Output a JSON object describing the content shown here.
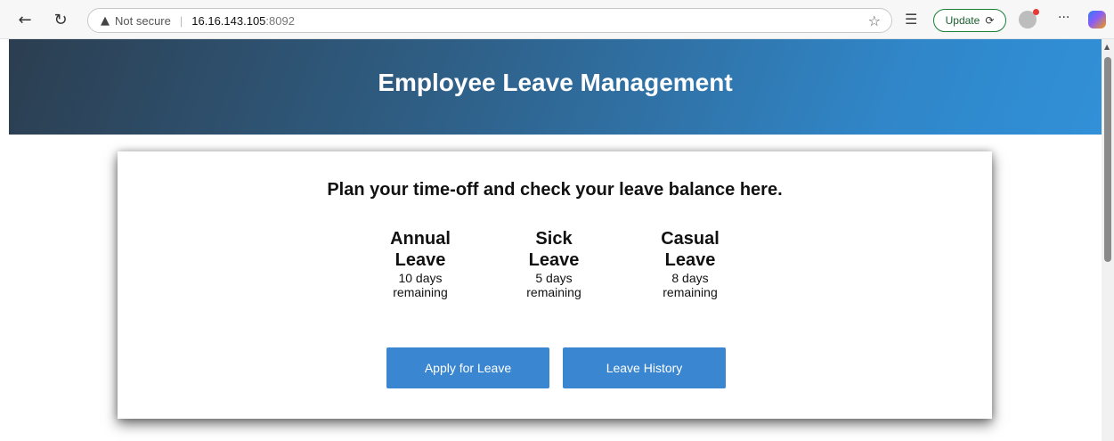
{
  "browser": {
    "not_secure": "Not secure",
    "host": "16.16.143.105",
    "port": ":8092",
    "update_label": "Update"
  },
  "page": {
    "header_title": "Employee Leave Management",
    "intro": "Plan your time-off and check your leave balance here.",
    "balances": [
      {
        "name_line1": "Annual",
        "name_line2": "Leave",
        "days": "10 days",
        "suffix": "remaining"
      },
      {
        "name_line1": "Sick",
        "name_line2": "Leave",
        "days": "5 days",
        "suffix": "remaining"
      },
      {
        "name_line1": "Casual",
        "name_line2": "Leave",
        "days": "8 days",
        "suffix": "remaining"
      }
    ],
    "apply_button": "Apply for Leave",
    "history_button": "Leave History"
  },
  "colors": {
    "header_gradient_start": "#2c3e50",
    "header_gradient_end": "#3190d8",
    "button_blue": "#3b86d0"
  },
  "icons": [
    "back-arrow-icon",
    "reload-icon",
    "warning-icon",
    "star-icon",
    "favorites-icon",
    "update-icon",
    "profile-icon",
    "more-icon",
    "copilot-icon"
  ]
}
